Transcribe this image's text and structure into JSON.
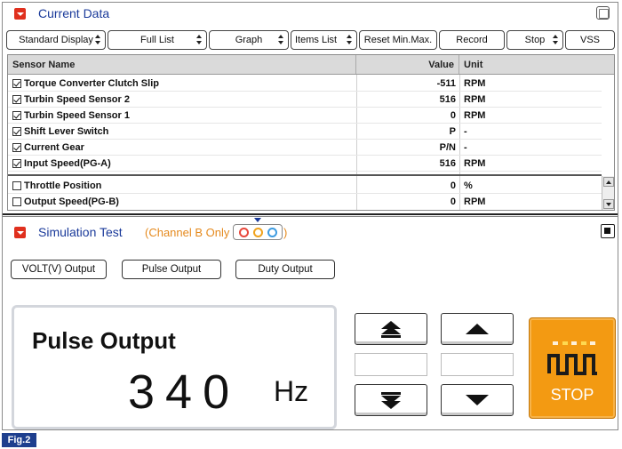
{
  "current_data": {
    "title": "Current Data",
    "toolbar": [
      {
        "label": "Standard Display",
        "dropdown": true
      },
      {
        "label": "Full List",
        "dropdown": true
      },
      {
        "label": "Graph",
        "dropdown": true
      },
      {
        "label": "Items List",
        "dropdown": true
      },
      {
        "label": "Reset Min.Max.",
        "dropdown": false
      },
      {
        "label": "Record",
        "dropdown": false
      },
      {
        "label": "Stop",
        "dropdown": true
      },
      {
        "label": "VSS",
        "dropdown": false
      }
    ],
    "columns": {
      "name": "Sensor Name",
      "value": "Value",
      "unit": "Unit"
    },
    "rows": [
      {
        "checked": true,
        "name": "Torque Converter Clutch Slip",
        "value": "-511",
        "unit": "RPM"
      },
      {
        "checked": true,
        "name": "Turbin Speed Sensor 2",
        "value": "516",
        "unit": "RPM"
      },
      {
        "checked": true,
        "name": "Turbin Speed Sensor 1",
        "value": "0",
        "unit": "RPM"
      },
      {
        "checked": true,
        "name": "Shift Lever Switch",
        "value": "P",
        "unit": "-"
      },
      {
        "checked": true,
        "name": "Current Gear",
        "value": "P/N",
        "unit": "-"
      },
      {
        "checked": true,
        "name": "Input Speed(PG-A)",
        "value": "516",
        "unit": "RPM"
      },
      {
        "checked": false,
        "name": "Throttle Position",
        "value": "0",
        "unit": "%"
      },
      {
        "checked": false,
        "name": "Output Speed(PG-B)",
        "value": "0",
        "unit": "RPM"
      }
    ]
  },
  "simulation": {
    "title": "Simulation Test",
    "channel_prefix": "(Channel B Only",
    "channel_suffix": ")",
    "channel_ring_colors": [
      "#e8473b",
      "#f0a21c",
      "#3d9be0"
    ],
    "output_buttons": [
      "VOLT(V) Output",
      "Pulse Output",
      "Duty Output"
    ],
    "display": {
      "title": "Pulse Output",
      "value": "340",
      "unit": "Hz"
    },
    "stop_label": "STOP"
  },
  "colors": {
    "accent_red": "#e0301e",
    "title_blue": "#1a3a9a",
    "channel_orange": "#e58a1e",
    "stop_orange": "#f39a12",
    "fig_blue": "#1e3f8e"
  },
  "figure_label": "Fig.2"
}
